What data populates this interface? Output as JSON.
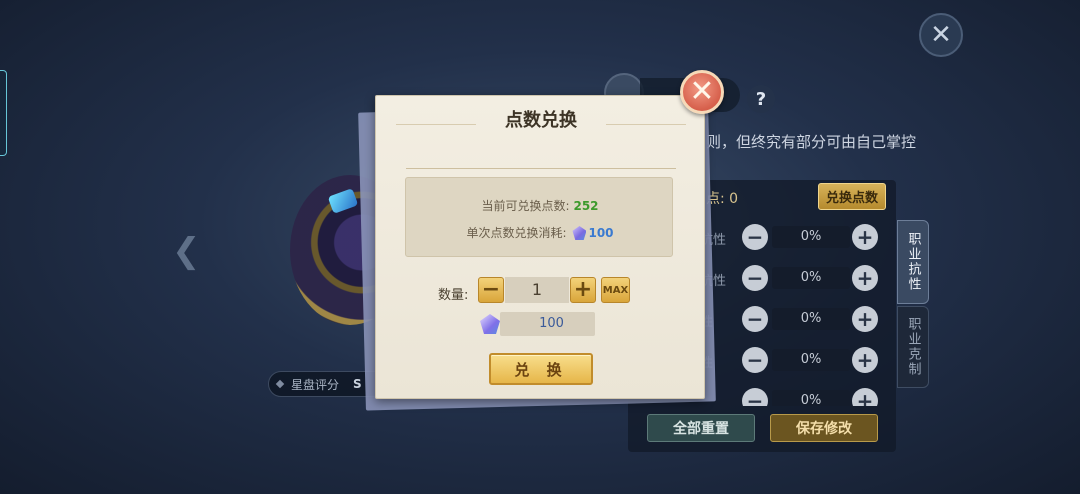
{
  "background": {
    "close_symbol": "✕",
    "prev_arrow": "❮",
    "star_rating_label": "星盘评分",
    "star_rating_value": "S",
    "panel": {
      "help_symbol": "?",
      "description": "则，但终究有部分可由自己掌控",
      "points_label": "点: 0",
      "exchange_points_button": "兑换点数",
      "rows": [
        {
          "label": "抗性",
          "value": "0%"
        },
        {
          "label": "抗性",
          "value": "0%"
        },
        {
          "label": "性",
          "value": "0%"
        },
        {
          "label": "性",
          "value": "0%"
        },
        {
          "label": "",
          "value": "0%"
        }
      ],
      "minus_symbol": "−",
      "plus_symbol": "+",
      "side_tab_resistance": "职业抗性",
      "side_tab_counter": "职业克制",
      "reset_all_button": "全部重置",
      "save_button": "保存修改"
    }
  },
  "modal": {
    "title": "点数兑换",
    "close_symbol": "✕",
    "available_label": "当前可兑换点数:",
    "available_value": "252",
    "cost_label": "单次点数兑换消耗:",
    "cost_value": "100",
    "quantity_label": "数量:",
    "minus_symbol": "−",
    "quantity_value": "1",
    "plus_symbol": "+",
    "max_label": "MAX",
    "total_cost": "100",
    "exchange_button": "兑 换"
  }
}
